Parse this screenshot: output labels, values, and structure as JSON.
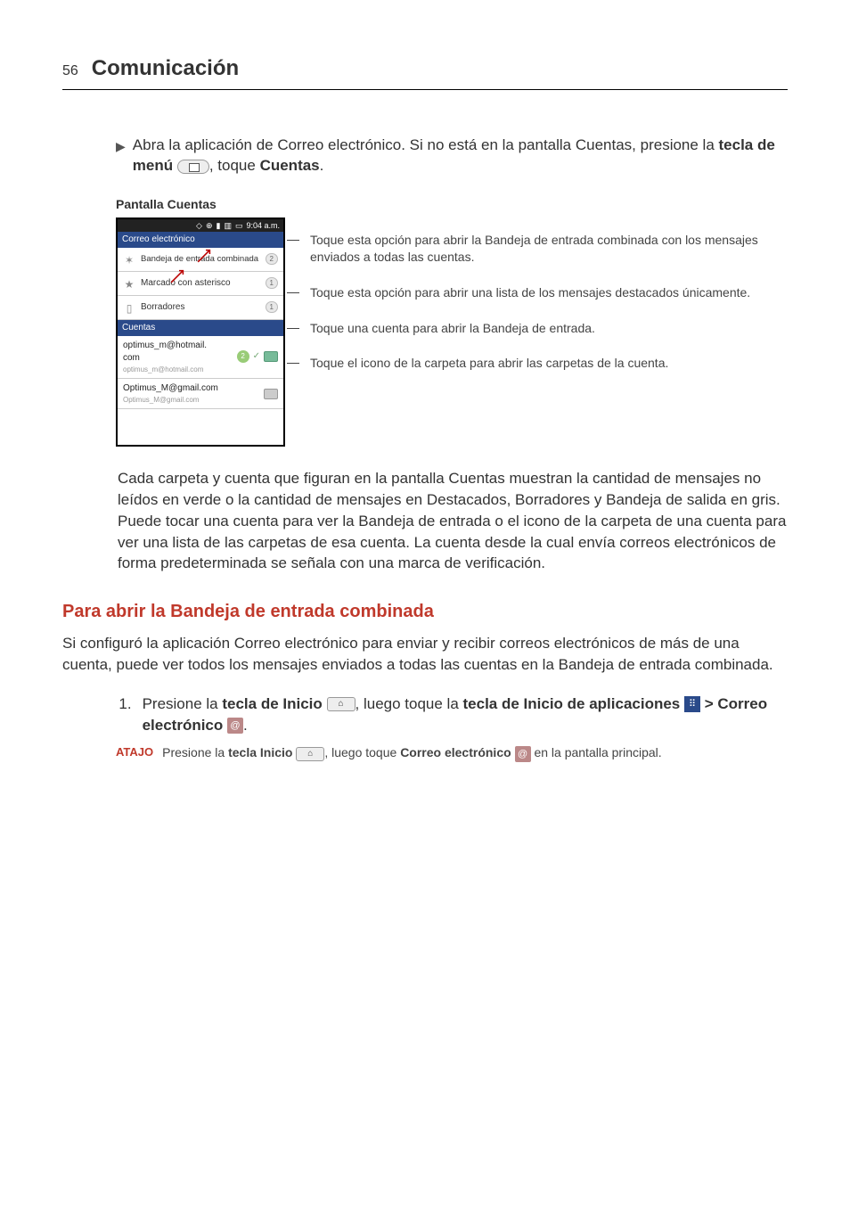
{
  "header": {
    "page_number": "56",
    "title": "Comunicación"
  },
  "bullet": {
    "pre": "Abra la aplicación de Correo electrónico. Si no está en la pantalla Cuentas, presione la ",
    "bold1": "tecla de menú ",
    "mid": ", toque ",
    "bold2": "Cuentas",
    "end": "."
  },
  "screenshot": {
    "caption": "Pantalla Cuentas",
    "status_time": "9:04 a.m.",
    "app_title": "Correo electrónico",
    "row1": {
      "label": "Bandeja de entrada combinada",
      "badge": "2"
    },
    "row2": {
      "label": "Marcado con asterisco",
      "badge": "1"
    },
    "row3": {
      "label": "Borradores",
      "badge": "1"
    },
    "accounts_header": "Cuentas",
    "acct1": {
      "line1": "optimus_m@hotmail.com",
      "line1_top": "optimus_m@hotmail.",
      "line2": "com",
      "count": "2"
    },
    "acct2": {
      "line1": "Optimus_M@gmail.com",
      "sub": "Optimus_M@gmail.com"
    }
  },
  "callouts": {
    "c1": "Toque esta opción para abrir la Bandeja de entrada combinada con los mensajes enviados a todas las cuentas.",
    "c2": "Toque esta opción para abrir una lista de los mensajes destacados únicamente.",
    "c3": "Toque una cuenta para abrir la Bandeja de entrada.",
    "c4": "Toque el icono de la carpeta para abrir las carpetas de la cuenta."
  },
  "para": "Cada carpeta y cuenta que figuran en la pantalla Cuentas muestran la cantidad de mensajes no leídos en verde o la cantidad de mensajes en Destacados, Borradores y Bandeja de salida en gris. Puede tocar una cuenta para ver la Bandeja de entrada o el icono de la carpeta de una cuenta para ver una lista de las carpetas de esa cuenta. La cuenta desde la cual envía correos electrónicos de forma predeterminada se señala con una marca de verificación.",
  "heading2": "Para abrir la Bandeja de entrada combinada",
  "intro2": "Si configuró la aplicación Correo electrónico para enviar y recibir correos electrónicos de más de una cuenta, puede ver todos los mensajes enviados a todas las cuentas en la Bandeja de entrada combinada.",
  "step1": {
    "num": "1.",
    "a": "Presione la ",
    "b": "tecla de Inicio ",
    "c": ", luego toque la ",
    "d": "tecla de Inicio de aplicaciones ",
    "e": " > ",
    "f": "Correo electrónico ",
    "g": "."
  },
  "atajo": {
    "label": "ATAJO",
    "a": "Presione la ",
    "b": "tecla Inicio ",
    "c": ", luego toque ",
    "d": "Correo electrónico ",
    "e": " en la pantalla principal."
  }
}
